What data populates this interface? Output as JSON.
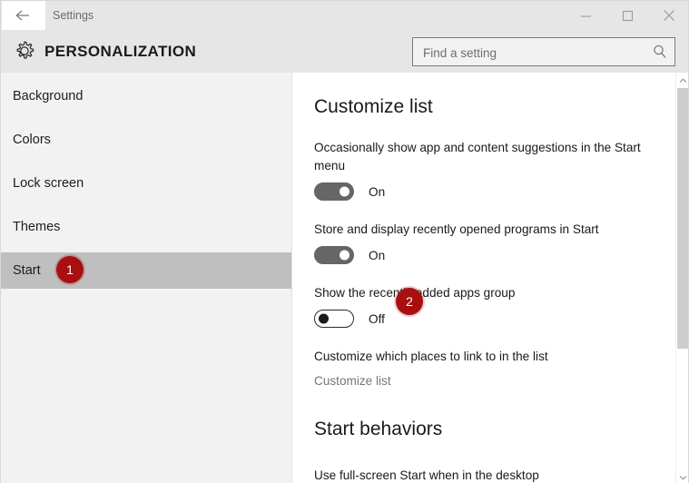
{
  "window": {
    "titlebar_title": "Settings",
    "controls": [
      {
        "name": "minimize",
        "glyph": "minimize-icon"
      },
      {
        "name": "maximize",
        "glyph": "maximize-icon"
      },
      {
        "name": "close",
        "glyph": "close-icon"
      }
    ],
    "back_icon": "back-arrow-icon"
  },
  "header": {
    "icon": "gear-icon",
    "title": "PERSONALIZATION"
  },
  "search": {
    "placeholder": "Find a setting",
    "value": "",
    "icon": "search-icon"
  },
  "sidebar": {
    "items": [
      {
        "label": "Background",
        "selected": false
      },
      {
        "label": "Colors",
        "selected": false
      },
      {
        "label": "Lock screen",
        "selected": false
      },
      {
        "label": "Themes",
        "selected": false
      },
      {
        "label": "Start",
        "selected": true
      }
    ]
  },
  "main": {
    "section1_title": "Customize list",
    "settings": [
      {
        "label": "Occasionally show app and content suggestions in the Start menu",
        "state": "On",
        "on": true
      },
      {
        "label": "Store and display recently opened programs in Start",
        "state": "On",
        "on": true
      },
      {
        "label": "Show the recently added apps group",
        "state": "Off",
        "on": false
      }
    ],
    "link_section_label": "Customize which places to link to in the list",
    "link_text": "Customize list",
    "section2_title": "Start behaviors",
    "section2_first_label": "Use full-screen Start when in the desktop"
  },
  "scrollbar": {
    "up_icon": "chevron-up-icon",
    "down_icon": "chevron-down-icon"
  },
  "annotations": [
    {
      "number": "1",
      "target": "sidebar-item-start"
    },
    {
      "number": "2",
      "target": "setting-recently-added-apps"
    }
  ],
  "colors": {
    "header_bg": "#e6e6e6",
    "sidebar_bg": "#f2f2f2",
    "selected_row": "#bfbfbf",
    "toggle_on": "#666666",
    "badge_red": "#a81010",
    "link_gray": "#767676"
  }
}
